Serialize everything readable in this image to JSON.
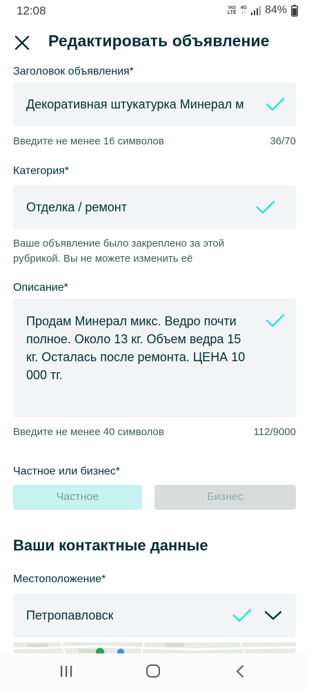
{
  "status": {
    "time": "12:08",
    "net_top": "Vo)",
    "net_bottom": "LTE",
    "net_type": "4G",
    "battery": "84%"
  },
  "header": {
    "title": "Редактировать объявление"
  },
  "form": {
    "title_field": {
      "label": "Заголовок объявления*",
      "value": "Декоративная штукатурка Минерал м",
      "helper": "Введите не менее 16 символов",
      "counter": "36/70"
    },
    "category_field": {
      "label": "Категория*",
      "value": "Отделка / ремонт",
      "helper_line1": "Ваше объявление было закреплено за этой",
      "helper_line2": "рубрикой. Вы не можете изменить её"
    },
    "description_field": {
      "label": "Описание*",
      "lines": [
        "Продам Минерал микс. Ведро почти",
        "полное. Около 13 кг. Объем ведра 15",
        "кг. Осталась после ремонта. ЦЕНА 10",
        "000 тг."
      ],
      "helper": "Введите не менее 40 символов",
      "counter": "112/9000"
    },
    "seller_type": {
      "label": "Частное или бизнес*",
      "option_private": "Частное",
      "option_business": "Бизнес"
    }
  },
  "contacts": {
    "title": "Ваши контактные данные",
    "location_label": "Местоположение*",
    "location_value": "Петропавловск"
  },
  "colors": {
    "accent_check": "#23e5db",
    "text_primary": "#002f34",
    "field_bg": "#f2f4f5",
    "selected_bg": "#c6f2f0"
  }
}
